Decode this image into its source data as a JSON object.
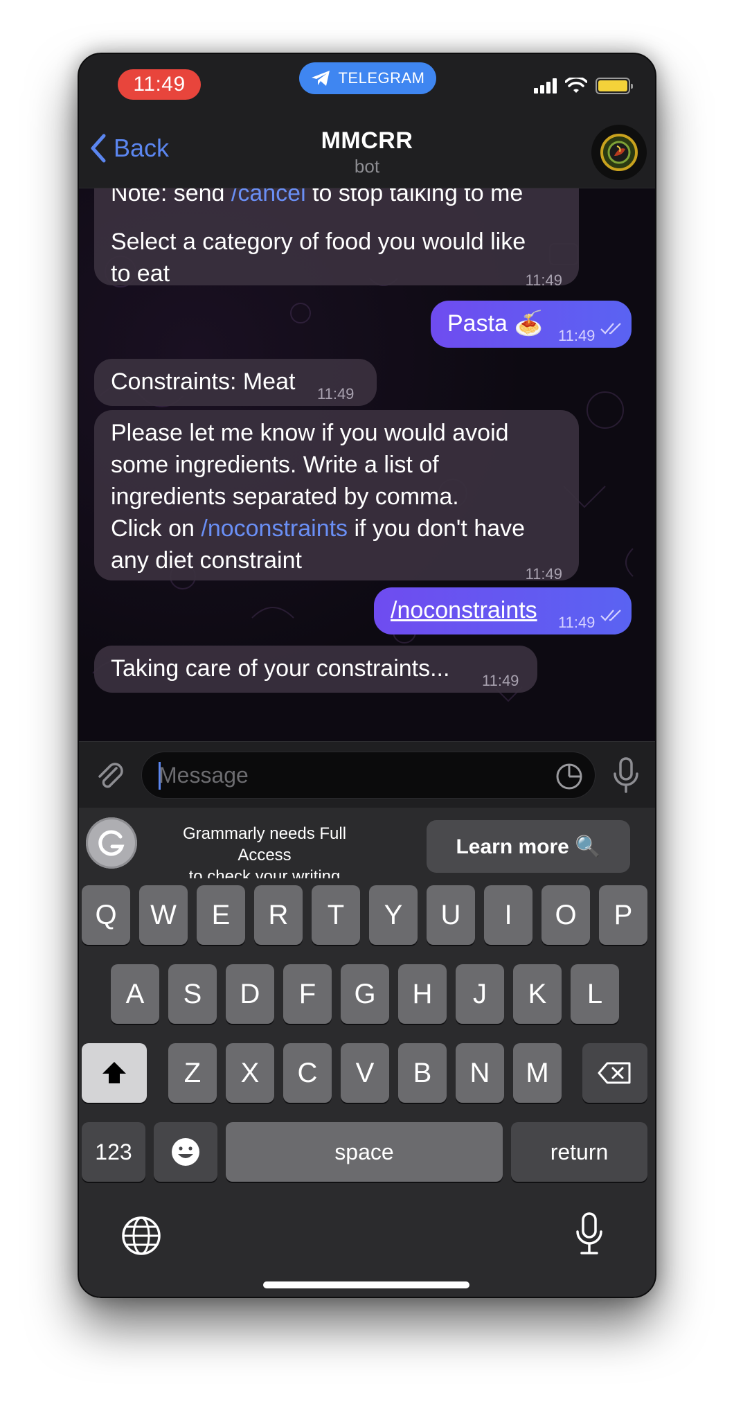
{
  "status_bar": {
    "time": "11:49",
    "app_pill": "TELEGRAM",
    "battery_level": 1.0
  },
  "header": {
    "back_label": "Back",
    "title": "MMCRR",
    "subtitle": "bot"
  },
  "messages": [
    {
      "direction": "in",
      "text": "Note: send /cancel to stop talking to me",
      "link": "/cancel",
      "pre": "Note: send ",
      "post": " to stop talking to me"
    },
    {
      "direction": "in",
      "text": "Select a category of food you would like to eat",
      "line1": "Select a category of food you would like",
      "line2": "to eat",
      "time": "11:49"
    },
    {
      "direction": "out",
      "text": "Pasta 🍝",
      "time": "11:49"
    },
    {
      "direction": "in",
      "text": "Constraints: Meat",
      "time": "11:49"
    },
    {
      "direction": "in",
      "lines": [
        "Please let me know if you would avoid",
        "some ingredients. Write a list of",
        "ingredients separated by comma."
      ],
      "link_pre": "Click on ",
      "link": "/noconstraints",
      "link_post": " if you don't have",
      "last_line": "any diet constraint",
      "time": "11:49"
    },
    {
      "direction": "out",
      "text": "/noconstraints",
      "time": "11:49"
    },
    {
      "direction": "in",
      "text": "Taking care of your constraints...",
      "time": "11:49"
    }
  ],
  "input": {
    "placeholder": "Message"
  },
  "grammarly": {
    "line1": "Grammarly needs Full Access",
    "line2": "to check your writing",
    "button": "Learn more 🔍"
  },
  "keyboard": {
    "row1": [
      "Q",
      "W",
      "E",
      "R",
      "T",
      "Y",
      "U",
      "I",
      "O",
      "P"
    ],
    "row2": [
      "A",
      "S",
      "D",
      "F",
      "G",
      "H",
      "J",
      "K",
      "L"
    ],
    "row3": [
      "Z",
      "X",
      "C",
      "V",
      "B",
      "N",
      "M"
    ],
    "numbers": "123",
    "space": "space",
    "return": "return"
  },
  "icons": {
    "back": "chevron-left-icon",
    "attach": "paperclip-icon",
    "sticker": "sticker-icon",
    "mic": "microphone-icon",
    "shift": "shift-icon",
    "delete": "backspace-icon",
    "emoji": "emoji-icon",
    "globe": "globe-icon",
    "dictation": "microphone-icon"
  },
  "colors": {
    "accent": "#5b86f0",
    "outgoing_bubble": "#6a52f1",
    "status_time_pill": "#e8453c",
    "telegram_pill": "#3f86f1"
  }
}
